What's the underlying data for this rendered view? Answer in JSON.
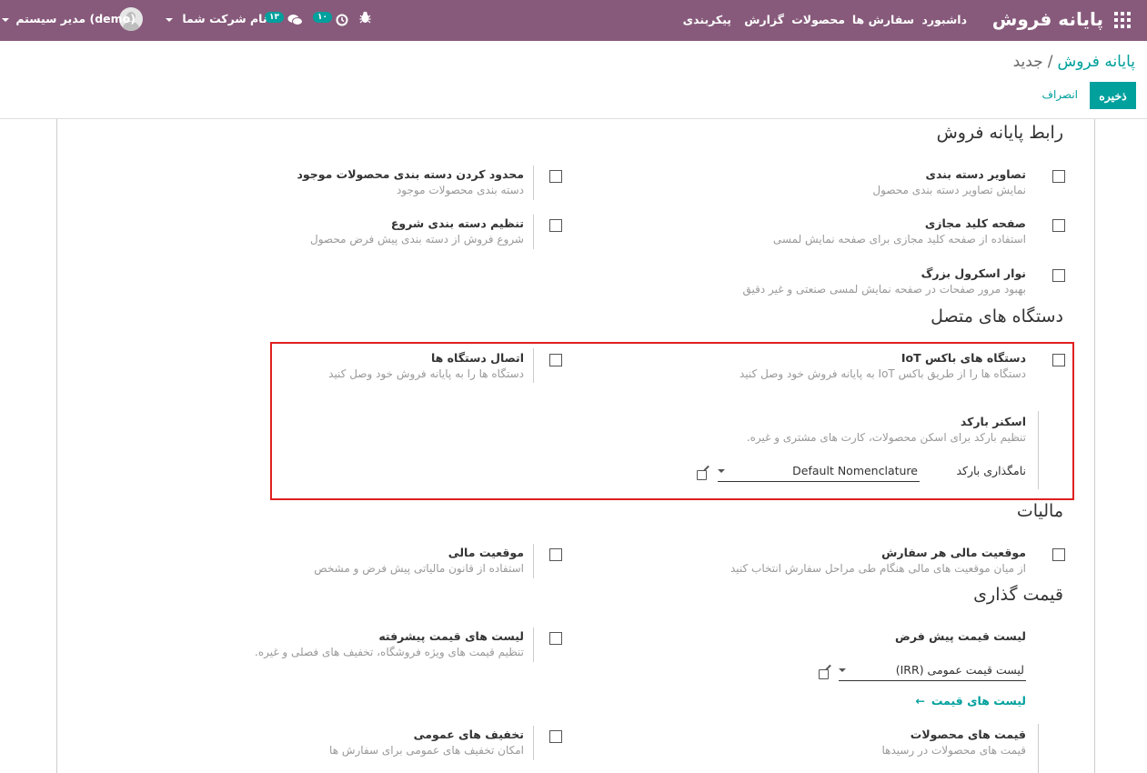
{
  "navbar": {
    "app_title": "پایانه فروش",
    "menu": [
      "داشبورد",
      "سفارش ها",
      "محصولات",
      "گزارش",
      "پیکربندی"
    ],
    "activity_badge": "۱۰",
    "messages_badge": "۱۳",
    "company_switcher": "نام شرکت شما",
    "user": "مدیر سیستم (demo)"
  },
  "breadcrumb": {
    "parent": "پایانه فروش",
    "separator": "/",
    "current": "جدید"
  },
  "buttons": {
    "save": "ذخیره",
    "discard": "انصراف"
  },
  "sections": {
    "pos_interface": "رابط پایانه فروش",
    "connected_devices": "دستگاه های متصل",
    "taxes": "مالیات",
    "pricing": "قیمت گذاری"
  },
  "settings": {
    "category_images": {
      "title": "تصاویر دسته بندی",
      "desc": "نمایش تصاویر دسته بندی محصول",
      "checked": false
    },
    "restrict_categories": {
      "title": "محدود کردن دسته بندی محصولات موجود",
      "desc": "دسته بندی محصولات موجود",
      "checked": false
    },
    "virtual_keyboard": {
      "title": "صفحه کلید مجازی",
      "desc": "استفاده از صفحه کلید مجازی برای صفحه نمایش لمسی",
      "checked": false
    },
    "start_category": {
      "title": "تنظیم دسته بندی شروع",
      "desc": "شروع فروش از دسته بندی پیش فرض محصول",
      "checked": false
    },
    "large_scrollbars": {
      "title": "نوار اسکرول بزرگ",
      "desc": "بهبود مرور صفحات در صفحه نمایش لمسی صنعتی و غیر دقیق",
      "checked": false
    },
    "iot_box": {
      "title": "دستگاه های باکس IoT",
      "desc": "دستگاه ها را از طریق باکس IoT به پایانه فروش خود وصل کنید",
      "checked": false
    },
    "connect_devices": {
      "title": "اتصال دستگاه ها",
      "desc": "دستگاه ها را به پایانه فروش خود وصل کنید",
      "checked": false
    },
    "barcode_scanner": {
      "title": "اسکنر بارکد",
      "desc": "تنظیم بارکد برای اسکن محصولات، کارت های مشتری و غیره.",
      "field_label": "نامگذاری بارکد",
      "field_value": "Default Nomenclature"
    },
    "fiscal_per_order": {
      "title": "موقعیت مالی هر سفارش",
      "desc": "از میان موقعیت های مالی هنگام طی مراحل سفارش انتخاب کنید",
      "checked": false
    },
    "fiscal_position": {
      "title": "موقعیت مالی",
      "desc": "استفاده از قانون مالیاتی پیش فرض و مشخص",
      "checked": false
    },
    "default_pricelist": {
      "title": "لیست قیمت پیش فرض",
      "field_value": "لیست قیمت عمومی (IRR)",
      "link": "لیست های قیمت"
    },
    "advanced_pricelists": {
      "title": "لیست های قیمت پیشرفته",
      "desc": "تنظیم قیمت های ویژه فروشگاه، تخفیف های فصلی و غیره.",
      "checked": false
    },
    "product_prices": {
      "title": "قیمت های محصولات",
      "desc": "قیمت های محصولات در رسیدها"
    },
    "global_discounts": {
      "title": "تخفیف های عمومی",
      "desc": "امکان تخفیف های عمومی برای سفارش ها",
      "checked": false
    }
  },
  "colors": {
    "navbar": "#875a7b",
    "accent": "#00a09d",
    "highlight": "#e02020"
  }
}
